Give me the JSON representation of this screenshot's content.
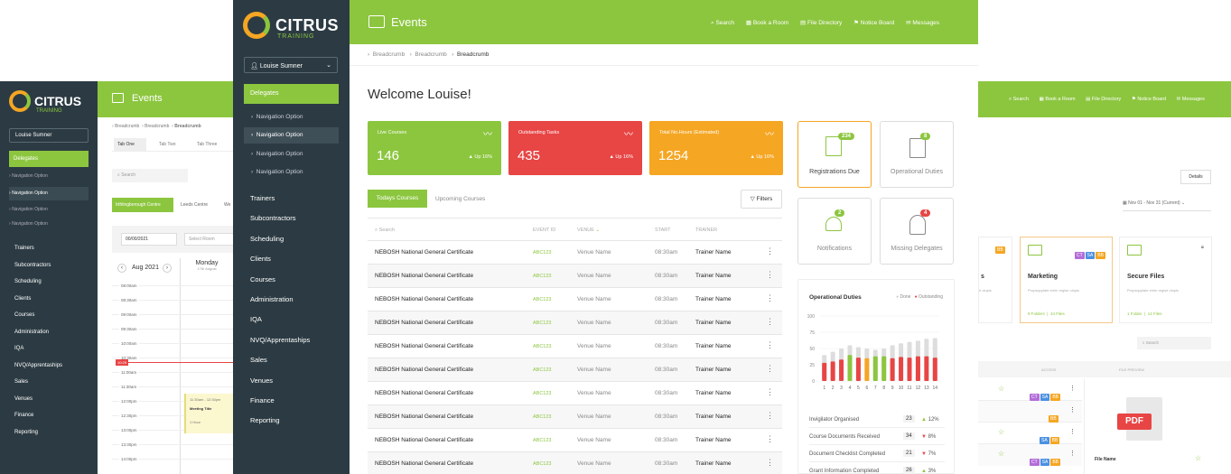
{
  "brand": {
    "name": "CITRUS",
    "sub": "TRAINING"
  },
  "page_title": "Events",
  "user": "Louise Sumner",
  "header_nav": [
    {
      "label": "Search",
      "icon": "search-icon"
    },
    {
      "label": "Book a Room",
      "icon": "calendar-icon"
    },
    {
      "label": "File Directory",
      "icon": "file-icon"
    },
    {
      "label": "Notice Board",
      "icon": "pin-icon"
    },
    {
      "label": "Messages",
      "icon": "mail-icon"
    }
  ],
  "breadcrumbs": [
    "Breadcrumb",
    "Breadcrumb",
    "Breadcrumb"
  ],
  "sidebar": {
    "active": "Delegates",
    "sub_items": [
      "Navigation Option",
      "Navigation Option",
      "Navigation Option",
      "Navigation Option"
    ],
    "items": [
      "Trainers",
      "Subcontractors",
      "Scheduling",
      "Clients",
      "Courses",
      "Administration",
      "IQA",
      "NVQ/Apprentaships",
      "Sales",
      "Venues",
      "Finance",
      "Reporting"
    ]
  },
  "welcome": "Welcome Louise!",
  "stat_cards": [
    {
      "label": "Live Courses",
      "value": "146",
      "trend": "Up 16%",
      "color": "#8cc63f"
    },
    {
      "label": "Outstanding Tasks",
      "value": "435",
      "trend": "Up 16%",
      "color": "#e84545"
    },
    {
      "label": "Total No.Hours (Estimated)",
      "value": "1254",
      "trend": "Up 16%",
      "color": "#f5a623"
    }
  ],
  "course_tabs": {
    "active": "Todays Courses",
    "inactive": "Upcoming Courses",
    "filters": "Filters"
  },
  "table": {
    "search": "Search",
    "headers": {
      "event_id": "EVENT ID",
      "venue": "VENUE",
      "start": "START",
      "trainer": "TRAINER"
    },
    "rows": [
      {
        "course": "NEBOSH National General Certificate",
        "id": "ABC123",
        "venue": "Venue Name",
        "start": "08:30am",
        "trainer": "Trainer Name"
      },
      {
        "course": "NEBOSH National General Certificate",
        "id": "ABC123",
        "venue": "Venue Name",
        "start": "08:30am",
        "trainer": "Trainer Name"
      },
      {
        "course": "NEBOSH National General Certificate",
        "id": "ABC123",
        "venue": "Venue Name",
        "start": "08:30am",
        "trainer": "Trainer Name"
      },
      {
        "course": "NEBOSH National General Certificate",
        "id": "ABC123",
        "venue": "Venue Name",
        "start": "08:30am",
        "trainer": "Trainer Name"
      },
      {
        "course": "NEBOSH National General Certificate",
        "id": "ABC123",
        "venue": "Venue Name",
        "start": "08:30am",
        "trainer": "Trainer Name"
      },
      {
        "course": "NEBOSH National General Certificate",
        "id": "ABC123",
        "venue": "Venue Name",
        "start": "08:30am",
        "trainer": "Trainer Name"
      },
      {
        "course": "NEBOSH National General Certificate",
        "id": "ABC123",
        "venue": "Venue Name",
        "start": "08:30am",
        "trainer": "Trainer Name"
      },
      {
        "course": "NEBOSH National General Certificate",
        "id": "ABC123",
        "venue": "Venue Name",
        "start": "08:30am",
        "trainer": "Trainer Name"
      },
      {
        "course": "NEBOSH National General Certificate",
        "id": "ABC123",
        "venue": "Venue Name",
        "start": "08:30am",
        "trainer": "Trainer Name"
      },
      {
        "course": "NEBOSH National General Certificate",
        "id": "ABC123",
        "venue": "Venue Name",
        "start": "08:30am",
        "trainer": "Trainer Name"
      }
    ]
  },
  "quick_tiles": [
    {
      "label": "Registrations Due",
      "count": "234",
      "badge_color": "#8cc63f"
    },
    {
      "label": "Operational Duties",
      "count": "8",
      "badge_color": "#8cc63f"
    },
    {
      "label": "Notifications",
      "count": "2",
      "badge_color": "#8cc63f"
    },
    {
      "label": "Missing Delegates",
      "count": "4",
      "badge_color": "#e84545"
    }
  ],
  "chart_data": {
    "type": "bar",
    "title": "Operational Duties",
    "legend": [
      "Done",
      "Outstanding"
    ],
    "categories": [
      "1",
      "2",
      "3",
      "4",
      "5",
      "6",
      "7",
      "8",
      "9",
      "10",
      "11",
      "12",
      "13",
      "14"
    ],
    "series": [
      {
        "name": "Done",
        "values": [
          40,
          45,
          50,
          55,
          52,
          50,
          48,
          50,
          55,
          58,
          60,
          62,
          65,
          66
        ]
      },
      {
        "name": "Outstanding",
        "values": [
          28,
          30,
          33,
          40,
          36,
          35,
          38,
          38,
          35,
          37,
          36,
          38,
          38,
          36
        ]
      }
    ],
    "ylim": [
      0,
      100
    ],
    "yticks": [
      "100",
      "75",
      "50",
      "25",
      "0"
    ],
    "colors": {
      "done": "#dddddd",
      "outstanding": "#e84545",
      "highlight": "#8cc63f",
      "mid": "#f5a623"
    }
  },
  "stats_list": [
    {
      "label": "Invigilator Organised",
      "value": "23",
      "change": "12%",
      "dir": "up"
    },
    {
      "label": "Course Documents Received",
      "value": "34",
      "change": "8%",
      "dir": "down"
    },
    {
      "label": "Document Checklist Completed",
      "value": "21",
      "change": "7%",
      "dir": "down"
    },
    {
      "label": "Grant Information Completed",
      "value": "26",
      "change": "3%",
      "dir": "up"
    }
  ],
  "left_screen": {
    "tabs": [
      "Tab One",
      "Tab Two",
      "Tab Three"
    ],
    "search": "Search",
    "centres": [
      "Irthlingborough Centre",
      "Leeds Centre",
      "We"
    ],
    "date_value": "00/00/2021",
    "room_placeholder": "Select Room",
    "month": "Aug 2021",
    "day": "Monday",
    "day_date": "17th August",
    "times": [
      "08:00am",
      "08:30am",
      "09:00am",
      "09:30am",
      "10:00am",
      "10:30am",
      "11:00am",
      "11:30am",
      "12:00pm",
      "12:30pm",
      "13:00pm",
      "13:30pm",
      "14:00pm"
    ],
    "now": "10:25",
    "event": {
      "time": "11:30am - 12:30pm",
      "title": "Meeting Title",
      "duration": "1 Hour"
    }
  },
  "right_screen": {
    "details": "Details",
    "date_range": "Nov 01 - Nov 31 (Current)",
    "folders": [
      {
        "name": "s",
        "desc": "e olupis",
        "tags": [
          "BB"
        ]
      },
      {
        "name": "Marketing",
        "desc": "Propsquytate enim regise olopis",
        "folders": "9 Folders",
        "files": "34 Files",
        "tags": [
          "CT",
          "SA",
          "BB"
        ]
      },
      {
        "name": "Secure Files",
        "desc": "Propsquytate enim regise olopis",
        "folders": "1 Folder",
        "files": "14 Files",
        "tags": []
      }
    ],
    "search": "Search",
    "col_access": "ACCESS",
    "col_preview": "FILE PREVIEW",
    "file_name": "File Name",
    "pdf": "PDF"
  }
}
